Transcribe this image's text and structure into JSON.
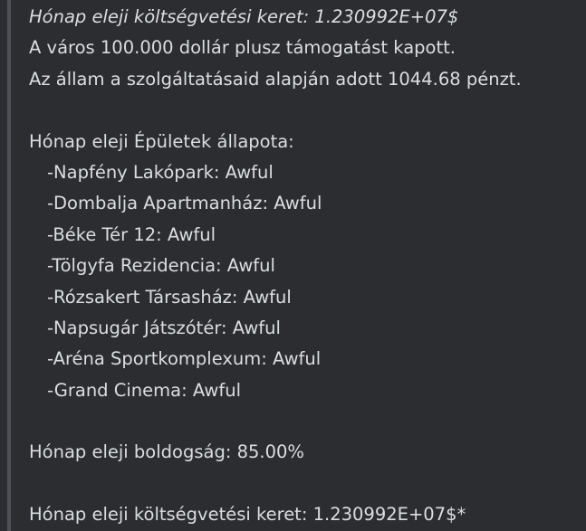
{
  "message": {
    "header_italic": "Hónap eleji költségvetési keret: 1.230992E+07$",
    "support_line": "A város 100.000 dollár plusz támogatást kapott.",
    "state_line": "Az állam a szolgáltatásaid alapján adott 1044.68 pénzt.",
    "buildings_title": "Hónap eleji Épületek állapota:",
    "buildings": [
      "-Napfény Lakópark: Awful",
      "-Dombalja Apartmanház: Awful",
      "-Béke Tér 12: Awful",
      "-Tölgyfa Rezidencia: Awful",
      "-Rózsakert Társasház: Awful",
      "-Napsugár Játszótér: Awful",
      "-Aréna Sportkomplexum: Awful",
      "-Grand Cinema: Awful"
    ],
    "happiness_line": "Hónap eleji boldogság: 85.00%",
    "budget_line": "Hónap eleji költségvetési keret: 1.230992E+07$*"
  },
  "colors": {
    "background": "#2b2d31",
    "text": "#dbdee1",
    "accent_bar": "#4e5058"
  }
}
